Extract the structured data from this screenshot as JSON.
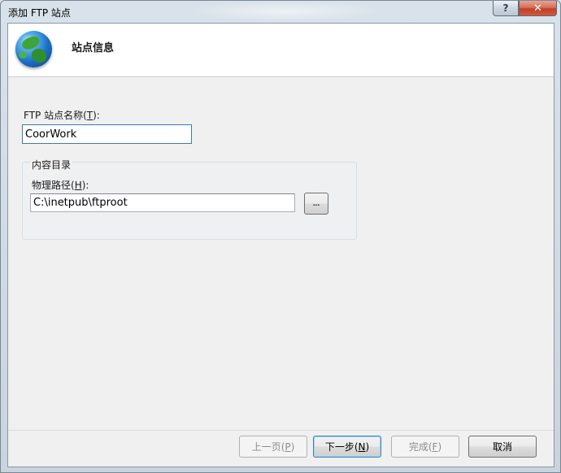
{
  "window": {
    "title": "添加 FTP 站点",
    "help_glyph": "?",
    "close_glyph": "✕"
  },
  "header": {
    "title": "站点信息",
    "icon": "globe-icon"
  },
  "form": {
    "site_name_label_prefix": "FTP 站点名称(",
    "site_name_hotkey": "T",
    "site_name_label_suffix": "):",
    "site_name_value": "CoorWork",
    "content_group_title": "内容目录",
    "path_label_prefix": "物理路径(",
    "path_hotkey": "H",
    "path_label_suffix": "):",
    "path_value": "C:\\inetpub\\ftproot",
    "browse_label": "..."
  },
  "buttons": {
    "prev_prefix": "上一页(",
    "prev_hotkey": "P",
    "next_prefix": "下一步(",
    "next_hotkey": "N",
    "finish_prefix": "完成(",
    "finish_hotkey": "F",
    "suffix": ")",
    "cancel": "取消"
  },
  "colors": {
    "close_button": "#c24026",
    "focus_border": "#3d7bad",
    "default_button_border": "#3c7fb1"
  }
}
